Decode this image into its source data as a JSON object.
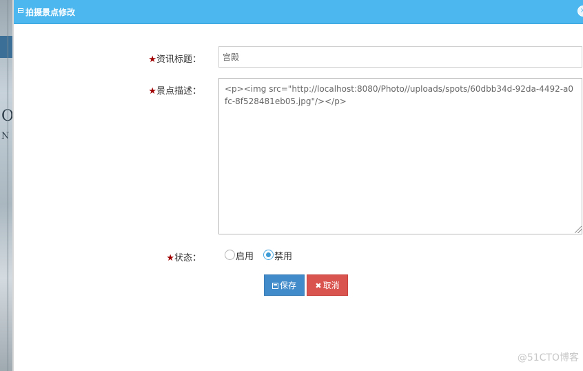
{
  "dialog": {
    "title": "拍摄景点修改",
    "close_glyph": "×"
  },
  "form": {
    "title_label": "资讯标题：",
    "title_value": "宫殿",
    "desc_label": "景点描述：",
    "desc_value": "<p><img src=\"http://localhost:8080/Photo//uploads/spots/60dbb34d-92da-4492-a0fc-8f528481eb05.jpg\"/></p>",
    "status_label": "状态：",
    "required_mark": "★",
    "status_options": [
      {
        "label": "启用",
        "checked": false
      },
      {
        "label": "禁用",
        "checked": true
      }
    ]
  },
  "buttons": {
    "save_label": "保存",
    "cancel_label": "取消",
    "cancel_glyph": "✖"
  },
  "background": {
    "fragment_1": "OI",
    "fragment_2": "N"
  },
  "watermark": "@51CTO博客",
  "colors": {
    "titlebar": "#4cb6ee",
    "save": "#428bca",
    "cancel": "#d9534f",
    "required": "#a00000"
  }
}
